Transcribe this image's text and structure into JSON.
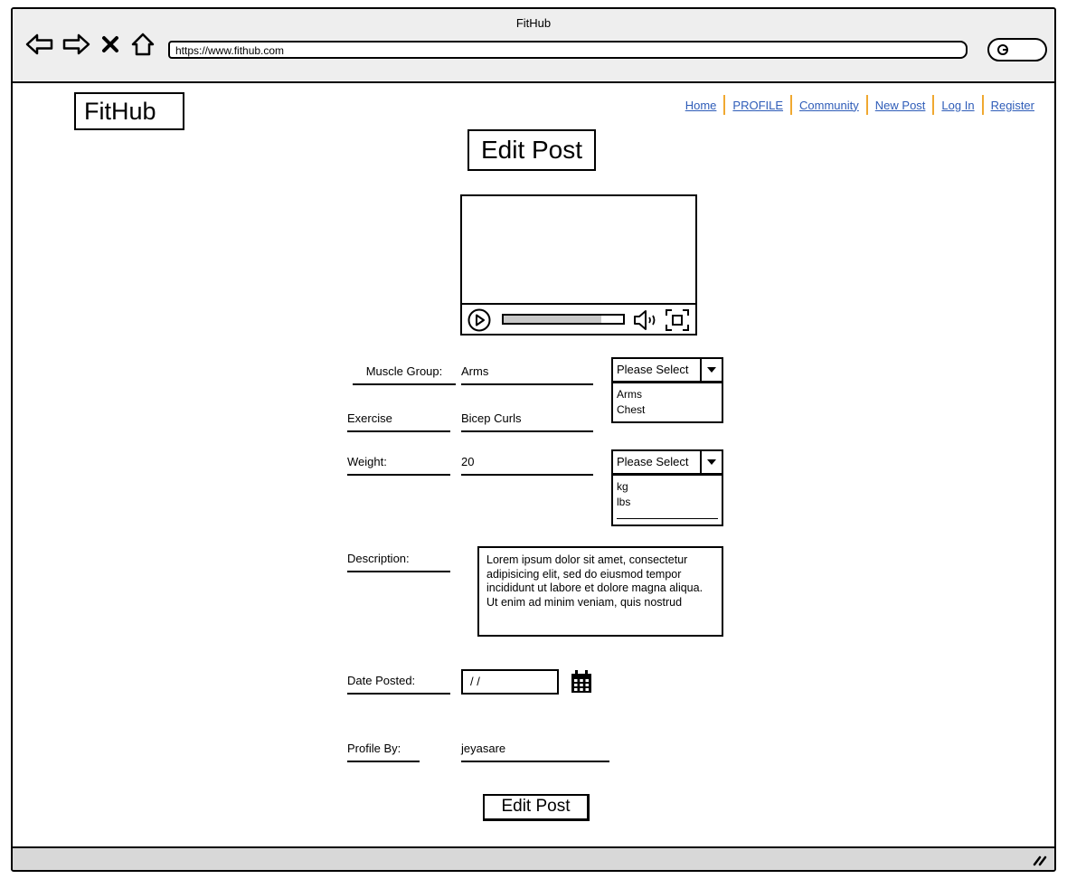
{
  "window": {
    "title": "FitHub"
  },
  "browser": {
    "url": "https://www.fithub.com"
  },
  "site": {
    "logo": "FitHub"
  },
  "nav": [
    "Home",
    "PROFILE",
    "Community",
    "New Post",
    "Log In",
    "Register"
  ],
  "page": {
    "title": "Edit Post"
  },
  "video": {
    "progress": 0.82
  },
  "form": {
    "muscle_group": {
      "label": "Muscle Group:",
      "value": "Arms",
      "select_placeholder": "Please Select",
      "options": [
        "Arms",
        "Chest"
      ]
    },
    "exercise": {
      "label": "Exercise",
      "value": "Bicep Curls"
    },
    "weight": {
      "label": "Weight:",
      "value": "20",
      "select_placeholder": "Please Select",
      "options": [
        "kg",
        "lbs"
      ]
    },
    "description": {
      "label": "Description:",
      "value": "Lorem ipsum dolor sit amet, consectetur adipisicing elit, sed do eiusmod tempor incididunt ut labore et dolore magna aliqua. Ut enim ad minim veniam, quis nostrud"
    },
    "date_posted": {
      "label": "Date Posted:",
      "value": " / /"
    },
    "profile_by": {
      "label": "Profile By:",
      "value": "jeyasare"
    },
    "submit_label": "Edit Post"
  },
  "colors": {
    "link": "#2e5cb8",
    "nav_separator": "#f0a830",
    "chrome": "#eeeeee"
  },
  "icons": [
    "back-arrow-icon",
    "forward-arrow-icon",
    "close-icon",
    "home-icon",
    "search-icon",
    "play-icon",
    "volume-icon",
    "fullscreen-icon",
    "calendar-icon",
    "chevron-down-icon",
    "resize-grip-icon"
  ]
}
